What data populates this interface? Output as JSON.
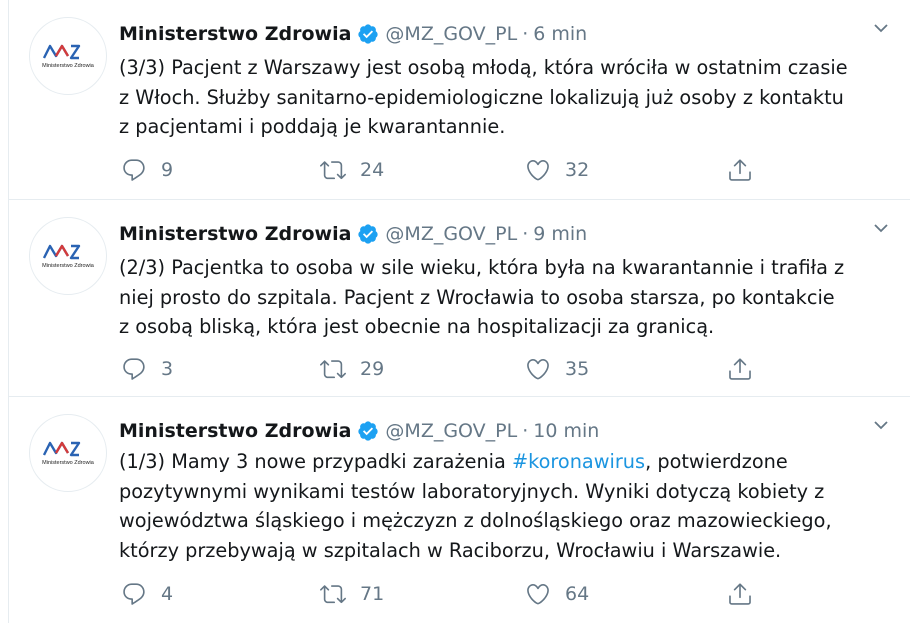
{
  "tweets": [
    {
      "avatar": {
        "logo_text": "Ministerstwo Zdrowia"
      },
      "name": "Ministerstwo Zdrowia",
      "handle": "@MZ_GOV_PL",
      "separator": "·",
      "time": "6 min",
      "lines": [
        "(3/3) Pacjent z Warszawy jest osobą młodą, która wróciła w ostatnim czasie",
        "z Włoch. Służby sanitarno-epidemiologiczne lokalizują już osoby z kontaktu",
        "z pacjentami i poddają je kwarantannie."
      ],
      "replies": "9",
      "retweets": "24",
      "likes": "32"
    },
    {
      "avatar": {
        "logo_text": "Ministerstwo Zdrowia"
      },
      "name": "Ministerstwo Zdrowia",
      "handle": "@MZ_GOV_PL",
      "separator": "·",
      "time": "9 min",
      "lines": [
        "(2/3) Pacjentka to osoba w sile wieku, która była na kwarantannie i trafiła z",
        "niej prosto do szpitala. Pacjent z Wrocławia to osoba starsza, po kontakcie",
        "z osobą bliską, która jest obecnie na hospitalizacji za granicą."
      ],
      "replies": "3",
      "retweets": "29",
      "likes": "35"
    },
    {
      "avatar": {
        "logo_text": "Ministerstwo Zdrowia"
      },
      "name": "Ministerstwo Zdrowia",
      "handle": "@MZ_GOV_PL",
      "separator": "·",
      "time": "10 min",
      "line1_prefix": "(1/3) Mamy 3 nowe przypadki zarażenia ",
      "line1_hashtag": "#koronawirus",
      "line1_suffix": ", potwierdzone",
      "lines": [
        "pozytywnymi wynikami testów laboratoryjnych. Wyniki dotyczą kobiety z",
        "województwa śląskiego i mężczyzn z dolnośląskiego oraz mazowieckiego,",
        "którzy przebywają w szpitalach w Raciborzu, Wrocławiu i Warszawie."
      ],
      "replies": "4",
      "retweets": "71",
      "likes": "64"
    }
  ],
  "icons": {
    "verified": "verified-badge-icon",
    "caret": "chevron-down-icon",
    "reply": "reply-icon",
    "retweet": "retweet-icon",
    "like": "heart-icon",
    "share": "share-icon"
  },
  "colors": {
    "text": "#14171a",
    "secondary": "#657786",
    "link": "#1b95e0",
    "verified": "#1da1f2",
    "border": "#e6ecf0"
  }
}
